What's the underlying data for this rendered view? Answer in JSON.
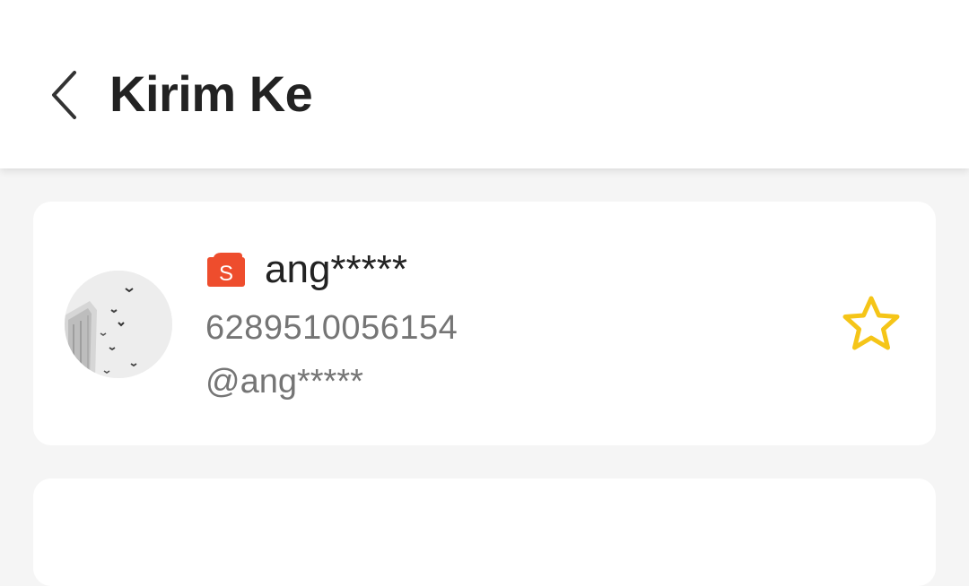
{
  "header": {
    "title": "Kirim Ke",
    "back_icon": "chevron-left-icon"
  },
  "contacts": [
    {
      "badge_icon": "shop-bag-icon",
      "badge_letter": "S",
      "name": "ang*****",
      "phone": "6289510056154",
      "handle": "@ang*****",
      "favorite_icon": "star-outline-icon"
    }
  ],
  "colors": {
    "background": "#f5f5f5",
    "card": "#ffffff",
    "title_text": "#222222",
    "secondary_text": "#757575",
    "brand_orange": "#ee4d2d",
    "star_yellow": "#f5c518"
  }
}
